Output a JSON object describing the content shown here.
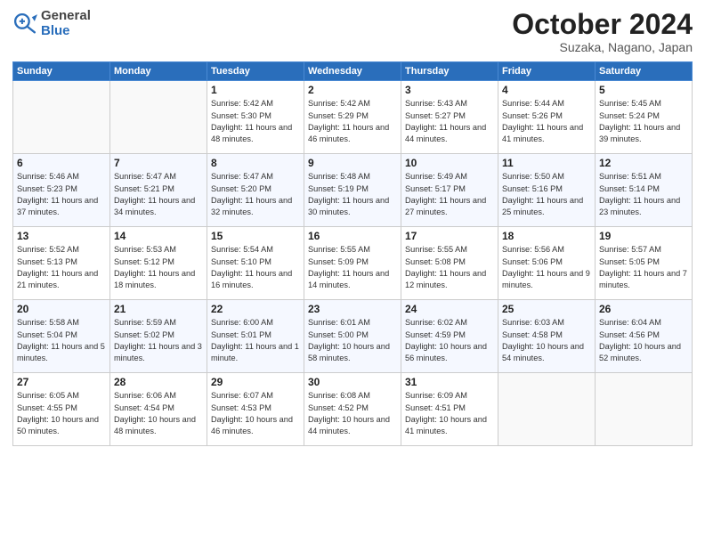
{
  "header": {
    "logo_general": "General",
    "logo_blue": "Blue",
    "month": "October 2024",
    "location": "Suzaka, Nagano, Japan"
  },
  "weekdays": [
    "Sunday",
    "Monday",
    "Tuesday",
    "Wednesday",
    "Thursday",
    "Friday",
    "Saturday"
  ],
  "weeks": [
    [
      {
        "day": "",
        "info": ""
      },
      {
        "day": "",
        "info": ""
      },
      {
        "day": "1",
        "info": "Sunrise: 5:42 AM\nSunset: 5:30 PM\nDaylight: 11 hours and 48 minutes."
      },
      {
        "day": "2",
        "info": "Sunrise: 5:42 AM\nSunset: 5:29 PM\nDaylight: 11 hours and 46 minutes."
      },
      {
        "day": "3",
        "info": "Sunrise: 5:43 AM\nSunset: 5:27 PM\nDaylight: 11 hours and 44 minutes."
      },
      {
        "day": "4",
        "info": "Sunrise: 5:44 AM\nSunset: 5:26 PM\nDaylight: 11 hours and 41 minutes."
      },
      {
        "day": "5",
        "info": "Sunrise: 5:45 AM\nSunset: 5:24 PM\nDaylight: 11 hours and 39 minutes."
      }
    ],
    [
      {
        "day": "6",
        "info": "Sunrise: 5:46 AM\nSunset: 5:23 PM\nDaylight: 11 hours and 37 minutes."
      },
      {
        "day": "7",
        "info": "Sunrise: 5:47 AM\nSunset: 5:21 PM\nDaylight: 11 hours and 34 minutes."
      },
      {
        "day": "8",
        "info": "Sunrise: 5:47 AM\nSunset: 5:20 PM\nDaylight: 11 hours and 32 minutes."
      },
      {
        "day": "9",
        "info": "Sunrise: 5:48 AM\nSunset: 5:19 PM\nDaylight: 11 hours and 30 minutes."
      },
      {
        "day": "10",
        "info": "Sunrise: 5:49 AM\nSunset: 5:17 PM\nDaylight: 11 hours and 27 minutes."
      },
      {
        "day": "11",
        "info": "Sunrise: 5:50 AM\nSunset: 5:16 PM\nDaylight: 11 hours and 25 minutes."
      },
      {
        "day": "12",
        "info": "Sunrise: 5:51 AM\nSunset: 5:14 PM\nDaylight: 11 hours and 23 minutes."
      }
    ],
    [
      {
        "day": "13",
        "info": "Sunrise: 5:52 AM\nSunset: 5:13 PM\nDaylight: 11 hours and 21 minutes."
      },
      {
        "day": "14",
        "info": "Sunrise: 5:53 AM\nSunset: 5:12 PM\nDaylight: 11 hours and 18 minutes."
      },
      {
        "day": "15",
        "info": "Sunrise: 5:54 AM\nSunset: 5:10 PM\nDaylight: 11 hours and 16 minutes."
      },
      {
        "day": "16",
        "info": "Sunrise: 5:55 AM\nSunset: 5:09 PM\nDaylight: 11 hours and 14 minutes."
      },
      {
        "day": "17",
        "info": "Sunrise: 5:55 AM\nSunset: 5:08 PM\nDaylight: 11 hours and 12 minutes."
      },
      {
        "day": "18",
        "info": "Sunrise: 5:56 AM\nSunset: 5:06 PM\nDaylight: 11 hours and 9 minutes."
      },
      {
        "day": "19",
        "info": "Sunrise: 5:57 AM\nSunset: 5:05 PM\nDaylight: 11 hours and 7 minutes."
      }
    ],
    [
      {
        "day": "20",
        "info": "Sunrise: 5:58 AM\nSunset: 5:04 PM\nDaylight: 11 hours and 5 minutes."
      },
      {
        "day": "21",
        "info": "Sunrise: 5:59 AM\nSunset: 5:02 PM\nDaylight: 11 hours and 3 minutes."
      },
      {
        "day": "22",
        "info": "Sunrise: 6:00 AM\nSunset: 5:01 PM\nDaylight: 11 hours and 1 minute."
      },
      {
        "day": "23",
        "info": "Sunrise: 6:01 AM\nSunset: 5:00 PM\nDaylight: 10 hours and 58 minutes."
      },
      {
        "day": "24",
        "info": "Sunrise: 6:02 AM\nSunset: 4:59 PM\nDaylight: 10 hours and 56 minutes."
      },
      {
        "day": "25",
        "info": "Sunrise: 6:03 AM\nSunset: 4:58 PM\nDaylight: 10 hours and 54 minutes."
      },
      {
        "day": "26",
        "info": "Sunrise: 6:04 AM\nSunset: 4:56 PM\nDaylight: 10 hours and 52 minutes."
      }
    ],
    [
      {
        "day": "27",
        "info": "Sunrise: 6:05 AM\nSunset: 4:55 PM\nDaylight: 10 hours and 50 minutes."
      },
      {
        "day": "28",
        "info": "Sunrise: 6:06 AM\nSunset: 4:54 PM\nDaylight: 10 hours and 48 minutes."
      },
      {
        "day": "29",
        "info": "Sunrise: 6:07 AM\nSunset: 4:53 PM\nDaylight: 10 hours and 46 minutes."
      },
      {
        "day": "30",
        "info": "Sunrise: 6:08 AM\nSunset: 4:52 PM\nDaylight: 10 hours and 44 minutes."
      },
      {
        "day": "31",
        "info": "Sunrise: 6:09 AM\nSunset: 4:51 PM\nDaylight: 10 hours and 41 minutes."
      },
      {
        "day": "",
        "info": ""
      },
      {
        "day": "",
        "info": ""
      }
    ]
  ]
}
